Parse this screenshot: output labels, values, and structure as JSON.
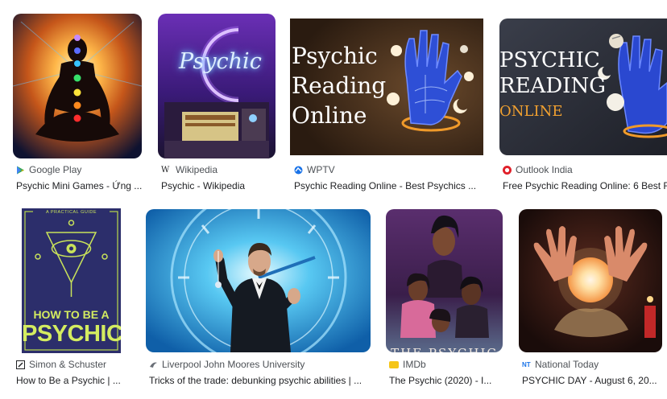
{
  "row1": [
    {
      "source": "Google Play",
      "title": "Psychic Mini Games - Ứng ...",
      "favicon": "google-play-icon",
      "thumb_desc": "meditating-silhouette-chakra-glow"
    },
    {
      "source": "Wikipedia",
      "title": "Psychic - Wikipedia",
      "favicon": "wikipedia-icon",
      "neon_text": "Psychic",
      "thumb_desc": "neon-psychic-sign-with-moon"
    },
    {
      "source": "WPTV",
      "title": "Psychic Reading Online - Best Psychics ...",
      "favicon": "wptv-icon",
      "overlay_line1": "Psychic",
      "overlay_line2": "Reading",
      "overlay_line3": "Online",
      "thumb_desc": "palmistry-hand-with-moons"
    },
    {
      "source": "Outlook India",
      "title": "Free Psychic Reading Online: 6 Best F",
      "favicon": "outlook-india-icon",
      "overlay_line1": "PSYCHIC",
      "overlay_line2": "READING",
      "overlay_line3": "ONLINE",
      "thumb_desc": "palmistry-hand-dark-background"
    }
  ],
  "row2": [
    {
      "source": "Simon & Schuster",
      "title": "How to Be a Psychic | ...",
      "favicon": "simon-schuster-icon",
      "book_top": "A PRACTICAL GUIDE",
      "book_line1": "HOW TO BE A",
      "book_line2": "PSYCHIC",
      "thumb_desc": "book-cover-all-seeing-eye"
    },
    {
      "source": "Liverpool John Moores University",
      "title": "Tricks of the trade: debunking psychic abilities | ...",
      "favicon": "ljmu-icon",
      "thumb_desc": "man-with-pendulum-clock-background"
    },
    {
      "source": "IMDb",
      "title": "The Psychic (2020) - I...",
      "favicon": "imdb-icon",
      "movie_text": "THE PSYCHIC",
      "thumb_desc": "movie-poster-three-women"
    },
    {
      "source": "National Today",
      "title": "PSYCHIC DAY - August 6, 20...",
      "favicon": "national-today-icon",
      "thumb_desc": "hands-over-crystal-ball"
    }
  ],
  "colors": {
    "source_text": "#4d5156",
    "title_text": "#202124",
    "background": "#ffffff"
  }
}
